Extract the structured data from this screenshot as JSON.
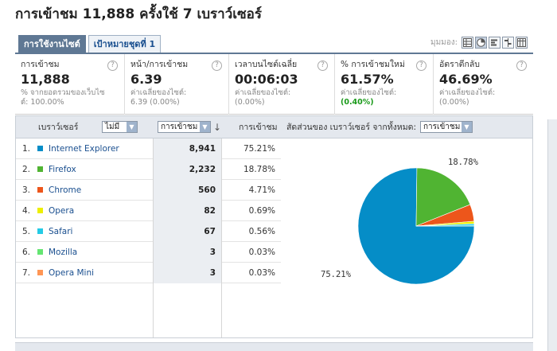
{
  "header": {
    "title": "การเข้าชม 11,888 ครั้งใช้ 7 เบราว์เซอร์"
  },
  "tabs": [
    {
      "label": "การใช้งานไซต์",
      "active": true
    },
    {
      "label": "เป้าหมายชุดที่ 1",
      "active": false
    }
  ],
  "view_as": {
    "label": "มุมมอง:",
    "buttons": [
      "table-view-icon",
      "pie-view-icon",
      "bar-view-icon",
      "comparison-view-icon",
      "pivot-view-icon"
    ],
    "selected": "pie-view-icon"
  },
  "metrics": [
    {
      "label": "การเข้าชม",
      "value": "11,888",
      "sub": "% จากยอดรวมของเว็บไซ",
      "subval": "ต์: 100.00%",
      "subval_green": false
    },
    {
      "label": "หน้า/การเข้าชม",
      "value": "6.39",
      "sub": "ค่าเฉลี่ยของไซต์:",
      "subval": "6.39 (0.00%)",
      "subval_green": false
    },
    {
      "label": "เวลาบนไซต์เฉลี่ย",
      "value": "00:06:03",
      "sub": "ค่าเฉลี่ยของไซต์:",
      "subval": "(0.00%)",
      "subval_green": false
    },
    {
      "label": "% การเข้าชมใหม่",
      "value": "61.57%",
      "sub": "ค่าเฉลี่ยของไซต์:",
      "subval": "(0.40%)",
      "subval_green": true
    },
    {
      "label": "อัตราตีกลับ",
      "value": "46.69%",
      "sub": "ค่าเฉลี่ยของไซต์:",
      "subval": "(0.00%)",
      "subval_green": false
    }
  ],
  "table": {
    "col_browser": "เบราว์เซอร์",
    "filter_select": "ไม่มี",
    "metric_select": "การเข้าชม",
    "col_visits": "การเข้าชม",
    "chart_caption": "สัดส่วนของ เบราว์เซอร์ จากทั้งหมด:",
    "chart_select": "การเข้าชม",
    "rows": [
      {
        "rank": "1.",
        "name": "Internet Explorer",
        "visits": "8,941",
        "pct": "75.21%",
        "color": "#058dc7"
      },
      {
        "rank": "2.",
        "name": "Firefox",
        "visits": "2,232",
        "pct": "18.78%",
        "color": "#50b432"
      },
      {
        "rank": "3.",
        "name": "Chrome",
        "visits": "560",
        "pct": "4.71%",
        "color": "#ed561b"
      },
      {
        "rank": "4.",
        "name": "Opera",
        "visits": "82",
        "pct": "0.69%",
        "color": "#edef00"
      },
      {
        "rank": "5.",
        "name": "Safari",
        "visits": "67",
        "pct": "0.56%",
        "color": "#24cbe5"
      },
      {
        "rank": "6.",
        "name": "Mozilla",
        "visits": "3",
        "pct": "0.03%",
        "color": "#64e572"
      },
      {
        "rank": "7.",
        "name": "Opera Mini",
        "visits": "3",
        "pct": "0.03%",
        "color": "#ff9655"
      }
    ]
  },
  "chart_data": {
    "type": "pie",
    "categories": [
      "Internet Explorer",
      "Firefox",
      "Chrome",
      "Opera",
      "Safari",
      "Mozilla",
      "Opera Mini"
    ],
    "values": [
      75.21,
      18.78,
      4.71,
      0.69,
      0.56,
      0.03,
      0.03
    ],
    "colors": [
      "#058dc7",
      "#50b432",
      "#ed561b",
      "#edef00",
      "#24cbe5",
      "#64e572",
      "#ff9655"
    ],
    "labels_shown": [
      "75.21%",
      "18.78%"
    ]
  }
}
